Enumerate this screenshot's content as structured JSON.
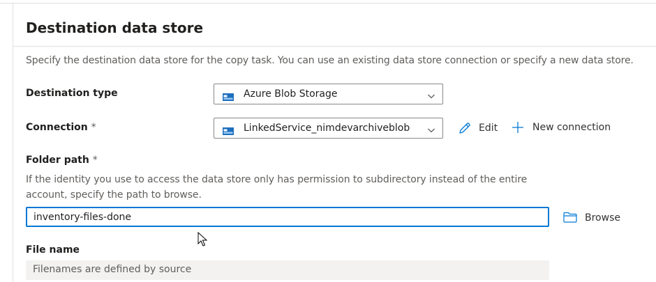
{
  "section": {
    "title": "Destination data store",
    "description": "Specify the destination data store for the copy task. You can use an existing data store connection or specify a new data store."
  },
  "destination_type": {
    "label": "Destination type",
    "selected": "Azure Blob Storage",
    "icon": "azure-blob-storage-icon"
  },
  "connection": {
    "label": "Connection",
    "required_marker": "*",
    "selected": "LinkedService_nimdevarchiveblob",
    "icon": "azure-blob-storage-icon",
    "edit_label": "Edit",
    "new_connection_label": "New connection"
  },
  "folder_path": {
    "label": "Folder path",
    "required_marker": "*",
    "help": "If the identity you use to access the data store only has permission to subdirectory instead of the entire account, specify the path to browse.",
    "value": "inventory-files-done",
    "browse_label": "Browse"
  },
  "file_name": {
    "label": "File name",
    "value": "Filenames are defined by source"
  },
  "colors": {
    "accent": "#0078d4",
    "text_primary": "#201f1e",
    "text_secondary": "#605e5c",
    "border": "#8a8886",
    "disabled_bg": "#f3f2f1"
  }
}
